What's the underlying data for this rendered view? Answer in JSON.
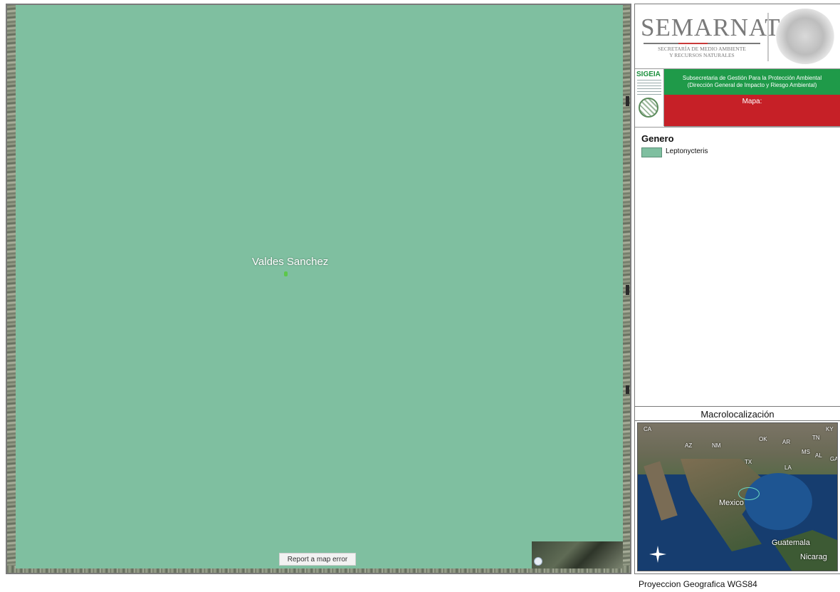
{
  "map": {
    "place_label": "Valdes Sanchez",
    "report_button": "Report a map error",
    "polygon_color": "#7fbfa0"
  },
  "header": {
    "logo_title": "SEMARNAT",
    "logo_subtitle_line1": "SECRETARÍA DE MEDIO AMBIENTE",
    "logo_subtitle_line2": "Y RECURSOS NATURALES",
    "sigeia_label": "SIGEIA",
    "subsecretaria_line1": "Subsecretaria de Gestión Para la Protección Ambiental",
    "subsecretaria_line2": "(Dirección General de Impacto y Riesgo Ambiental)",
    "mapa_label": "Mapa:"
  },
  "legend": {
    "title": "Genero",
    "items": [
      {
        "label": "Leptonycteris",
        "color": "#7fbfa0"
      }
    ]
  },
  "macro": {
    "title": "Macrolocalización",
    "labels": {
      "ca": "CA",
      "az": "AZ",
      "nm": "NM",
      "tx": "TX",
      "ok": "OK",
      "ar": "AR",
      "tn": "TN",
      "ms": "MS",
      "al": "AL",
      "la": "LA",
      "ga": "GA",
      "ky": "KY",
      "mexico": "Mexico",
      "guatemala": "Guatemala",
      "nicaragua": "Nicarag"
    }
  },
  "footer": {
    "projection": "Proyeccion Geografica WGS84"
  }
}
